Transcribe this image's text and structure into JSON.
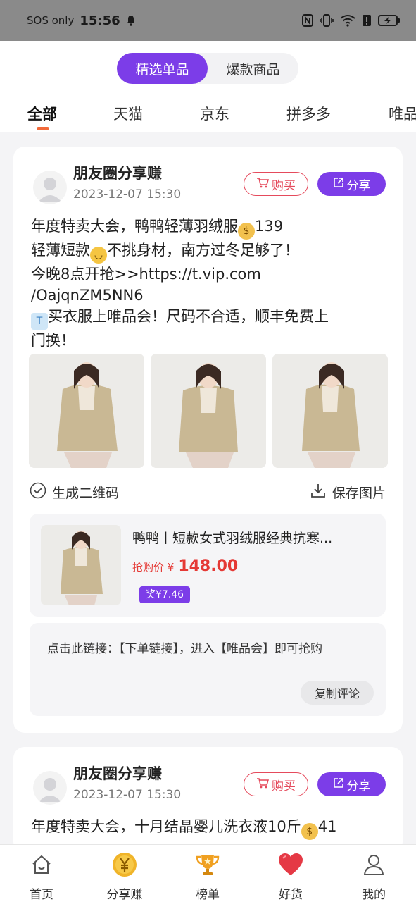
{
  "status_bar": {
    "carrier": "SOS only",
    "time": "15:56",
    "icons": [
      "bell-icon",
      "nfc-icon",
      "vibrate-icon",
      "wifi-icon",
      "alert-icon",
      "battery-charging-icon"
    ]
  },
  "segment": {
    "items": [
      {
        "label": "精选单品",
        "active": true
      },
      {
        "label": "爆款商品",
        "active": false
      }
    ]
  },
  "platform_tabs": [
    {
      "label": "全部",
      "active": true
    },
    {
      "label": "天猫",
      "active": false
    },
    {
      "label": "京东",
      "active": false
    },
    {
      "label": "拼多多",
      "active": false
    },
    {
      "label": "唯品会",
      "active": false
    }
  ],
  "posts": [
    {
      "title": "朋友圈分享赚",
      "time": "2023-12-07 15:30",
      "buy_label": "购买",
      "share_label": "分享",
      "text_lines": [
        "年度特卖大会，鸭鸭轻薄羽绒服",
        "139",
        "轻薄短款",
        "不挑身材，南方过冬足够了！",
        "今晚8点开抢>>https://t.vip.com",
        "/OajqnZM5NN6",
        "买衣服上唯品会！尺码不合适，顺丰免费上",
        "门换！"
      ],
      "qr_label": "生成二维码",
      "save_label": "保存图片",
      "product": {
        "title": "鸭鸭丨短款女式羽绒服经典抗寒...",
        "price_label": "抢购价 ¥",
        "price": "148.00",
        "reward": "奖¥7.46"
      },
      "comment": "点击此链接：【下单链接】，进入【唯品会】即可抢购",
      "copy_label": "复制评论"
    },
    {
      "title": "朋友圈分享赚",
      "time": "2023-12-07 15:30",
      "buy_label": "购买",
      "share_label": "分享",
      "text_line1_a": "年度特卖大会，十月结晶婴儿洗衣液10斤",
      "text_line1_b": "41"
    }
  ],
  "bottom_nav": [
    {
      "label": "首页",
      "icon": "home-icon"
    },
    {
      "label": "分享赚",
      "icon": "yuan-coin-icon"
    },
    {
      "label": "榜单",
      "icon": "trophy-icon"
    },
    {
      "label": "好货",
      "icon": "heart-icon"
    },
    {
      "label": "我的",
      "icon": "user-icon"
    }
  ],
  "colors": {
    "accent": "#7c3de8",
    "price_red": "#e53935",
    "buy_red": "#e54a5c",
    "tab_indicator": "#f26a3a"
  }
}
